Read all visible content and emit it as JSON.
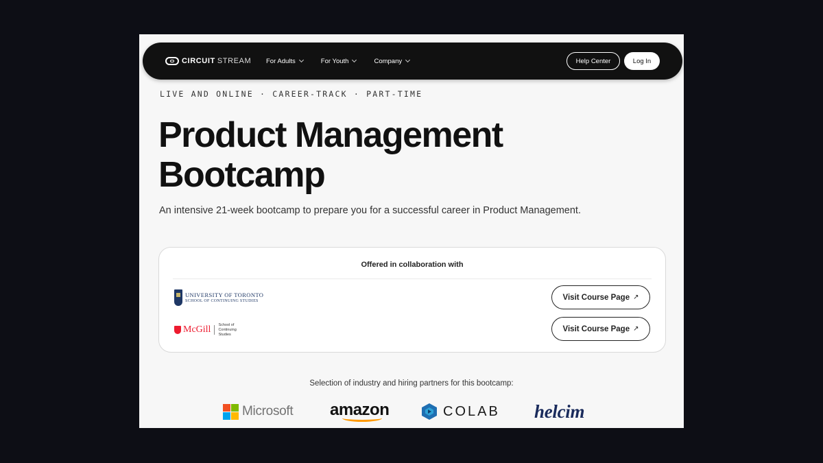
{
  "nav": {
    "logo_part1": "CIRCUIT",
    "logo_part2": "STREAM",
    "links": [
      {
        "label": "For Adults"
      },
      {
        "label": "For Youth"
      },
      {
        "label": "Company"
      }
    ],
    "help_label": "Help Center",
    "login_label": "Log In"
  },
  "hero": {
    "eyebrow": "LIVE AND ONLINE · CAREER-TRACK · PART-TIME",
    "title_line1": "Product Management",
    "title_line2": "Bootcamp",
    "subtitle": "An intensive 21-week bootcamp to prepare you for a successful career in Product Management."
  },
  "collab": {
    "title": "Offered in collaboration with",
    "partners": [
      {
        "logo_line1": "UNIVERSITY OF TORONTO",
        "logo_line2": "SCHOOL OF CONTINUING STUDIES",
        "button_label": "Visit Course Page",
        "accent": "#1e3765"
      },
      {
        "logo_name": "McGill",
        "logo_sub": "School of Continuing Studies",
        "button_label": "Visit Course Page",
        "accent": "#ed1b2f"
      }
    ],
    "arrow_icon": "↗"
  },
  "hiring": {
    "title": "Selection of industry and hiring partners for this bootcamp:",
    "logos": [
      {
        "name": "Microsoft",
        "colors": [
          "#f25022",
          "#7fba00",
          "#00a4ef",
          "#ffb900"
        ]
      },
      {
        "name": "amazon",
        "accent": "#ff9900"
      },
      {
        "name": "COLAB",
        "accent": "#1f6fb2"
      },
      {
        "name": "helcim",
        "accent": "#1a2b5c"
      }
    ]
  }
}
